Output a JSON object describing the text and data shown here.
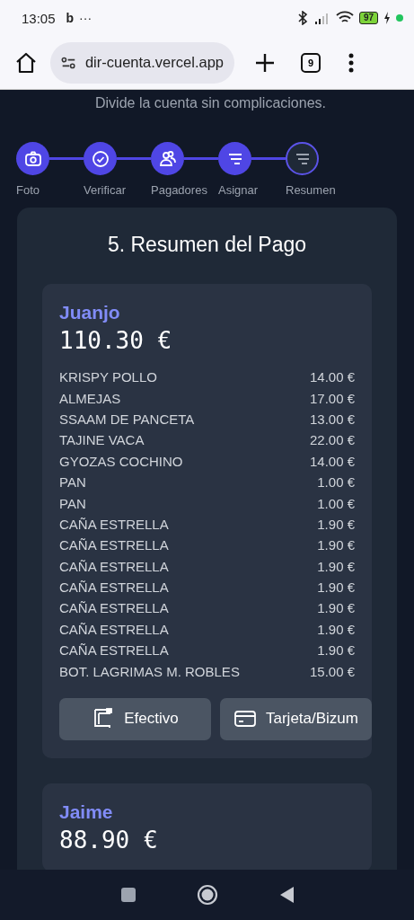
{
  "status_bar": {
    "time": "13:05",
    "notification_glyph": "b",
    "more": "···",
    "battery": "97"
  },
  "browser": {
    "url": "dir-cuenta.vercel.app",
    "tab_count": "9"
  },
  "subtitle": "Divide la cuenta sin complicaciones.",
  "steps": [
    {
      "label": "Foto",
      "kind": "camera",
      "completed": true
    },
    {
      "label": "Verificar",
      "kind": "check",
      "completed": true
    },
    {
      "label": "Pagadores",
      "kind": "users",
      "completed": true
    },
    {
      "label": "Asignar",
      "kind": "list",
      "completed": true
    },
    {
      "label": "Resumen",
      "kind": "list",
      "completed": false
    }
  ],
  "summary": {
    "title": "5. Resumen del Pago",
    "payers": [
      {
        "name": "Juanjo",
        "total": "110.30 €",
        "items": [
          {
            "name": "KRISPY POLLO",
            "price": "14.00 €"
          },
          {
            "name": "ALMEJAS",
            "price": "17.00 €"
          },
          {
            "name": "SSAAM DE PANCETA",
            "price": "13.00 €"
          },
          {
            "name": "TAJINE VACA",
            "price": "22.00 €"
          },
          {
            "name": "GYOZAS COCHINO",
            "price": "14.00 €"
          },
          {
            "name": "PAN",
            "price": "1.00 €"
          },
          {
            "name": "PAN",
            "price": "1.00 €"
          },
          {
            "name": "CAÑA ESTRELLA",
            "price": "1.90 €"
          },
          {
            "name": "CAÑA ESTRELLA",
            "price": "1.90 €"
          },
          {
            "name": "CAÑA ESTRELLA",
            "price": "1.90 €"
          },
          {
            "name": "CAÑA ESTRELLA",
            "price": "1.90 €"
          },
          {
            "name": "CAÑA ESTRELLA",
            "price": "1.90 €"
          },
          {
            "name": "CAÑA ESTRELLA",
            "price": "1.90 €"
          },
          {
            "name": "CAÑA ESTRELLA",
            "price": "1.90 €"
          },
          {
            "name": "BOT. LAGRIMAS M. ROBLES",
            "price": "15.00 €"
          }
        ],
        "buttons": [
          {
            "label": "Efectivo",
            "kind": "cash"
          },
          {
            "label": "Tarjeta/Bizum",
            "kind": "card"
          }
        ]
      },
      {
        "name": "Jaime",
        "total": "88.90 €"
      }
    ]
  }
}
